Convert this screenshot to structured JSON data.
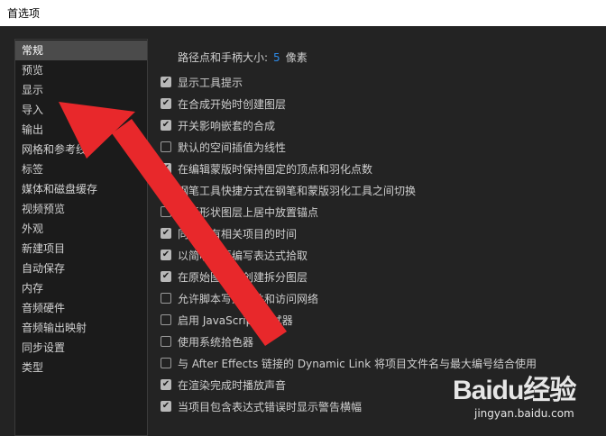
{
  "window": {
    "title": "首选项"
  },
  "sidebar": {
    "items": [
      {
        "label": "常规",
        "active": true
      },
      {
        "label": "预览"
      },
      {
        "label": "显示"
      },
      {
        "label": "导入"
      },
      {
        "label": "输出"
      },
      {
        "label": "网格和参考线"
      },
      {
        "label": "标签"
      },
      {
        "label": "媒体和磁盘缓存"
      },
      {
        "label": "视频预览"
      },
      {
        "label": "外观"
      },
      {
        "label": "新建项目"
      },
      {
        "label": "自动保存"
      },
      {
        "label": "内存"
      },
      {
        "label": "音频硬件"
      },
      {
        "label": "音频输出映射"
      },
      {
        "label": "同步设置"
      },
      {
        "label": "类型"
      }
    ]
  },
  "main": {
    "handle_size": {
      "label": "路径点和手柄大小:",
      "value": "5",
      "unit": "像素"
    },
    "options": [
      {
        "label": "显示工具提示",
        "checked": true
      },
      {
        "label": "在合成开始时创建图层",
        "checked": true
      },
      {
        "label": "开关影响嵌套的合成",
        "checked": true
      },
      {
        "label": "默认的空间插值为线性",
        "checked": false
      },
      {
        "label": "在编辑蒙版时保持固定的顶点和羽化点数",
        "checked": true
      },
      {
        "label": "钢笔工具快捷方式在钢笔和蒙版羽化工具之间切换",
        "checked": true
      },
      {
        "label": "在新形状图层上居中放置锚点",
        "checked": false
      },
      {
        "label": "同步所有相关项目的时间",
        "checked": true
      },
      {
        "label": "以简明英语编写表达式拾取",
        "checked": true
      },
      {
        "label": "在原始图层上创建拆分图层",
        "checked": true
      },
      {
        "label": "允许脚本写入文件和访问网络",
        "checked": false
      },
      {
        "label": "启用 JavaScript 调试器",
        "checked": false
      },
      {
        "label": "使用系统拾色器",
        "checked": false
      },
      {
        "label": "与 After Effects 链接的 Dynamic Link 将项目文件名与最大编号结合使用",
        "checked": false
      },
      {
        "label": "在渲染完成时播放声音",
        "checked": true
      },
      {
        "label": "当项目包含表达式错误时显示警告横幅",
        "checked": true
      }
    ]
  },
  "watermark": {
    "logo": "Baidu经验",
    "sub": "jingyan.baidu.com"
  },
  "colors": {
    "accent": "#2d8ceb",
    "arrow": "#e8282b"
  },
  "icons": {
    "check": "checkmark-icon",
    "arrow": "red-arrow-annotation"
  }
}
